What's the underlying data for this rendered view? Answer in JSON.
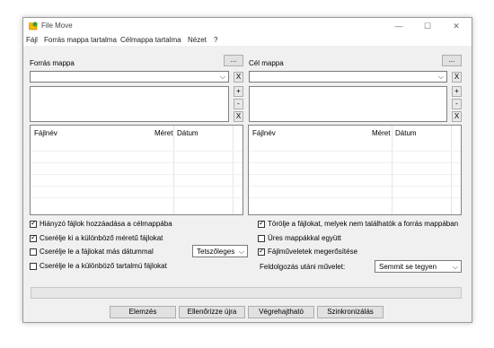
{
  "window": {
    "title": "File Move",
    "minimize": "—",
    "maximize": "☐",
    "close": "✕"
  },
  "menu": [
    "Fájl",
    "Forrás mappa tartalma",
    "Célmappa tartalma",
    "Nézet",
    "?"
  ],
  "source": {
    "label": "Forrás mappa",
    "browse": "...",
    "path": "",
    "clear": "X",
    "add": "+",
    "remove": "-",
    "clear_list": "X"
  },
  "target": {
    "label": "Cél mappa",
    "browse": "...",
    "path": "",
    "clear": "X",
    "add": "+",
    "remove": "-",
    "clear_list": "X"
  },
  "columns": {
    "name": "Fájlnév",
    "size": "Méret",
    "date": "Dátum"
  },
  "options_left": [
    {
      "label": "Hiányzó fájlok hozzáadása a célmappába",
      "checked": true
    },
    {
      "label": "Cserélje ki a különböző méretű fájlokat",
      "checked": true
    },
    {
      "label": "Cserélje le a fájlokat más dátummal",
      "checked": false
    },
    {
      "label": "Cserélje le a különböző tartalmú fájlokat",
      "checked": false
    }
  ],
  "date_mode": {
    "value": "Tetszőleges"
  },
  "options_right": [
    {
      "label": "Törölje a fájlokat, melyek nem találhatók a forrás mappában",
      "checked": true
    },
    {
      "label": "Üres mappákkal együtt",
      "checked": false
    },
    {
      "label": "Fájlműveletek megerősítése",
      "checked": true
    }
  ],
  "post_action": {
    "label": "Feldolgozás utáni művelet:",
    "value": "Semmit se tegyen"
  },
  "buttons": {
    "analyze": "Elemzés",
    "recheck": "Ellenőrizze újra",
    "execute": "Végrehajtható",
    "sync": "Szinkronizálás"
  },
  "icons": {
    "app": "folder-move-icon",
    "dropdown": "chevron-down-icon"
  },
  "colors": {
    "app_icon": "#f5b800",
    "app_icon_accent": "#3aa038"
  }
}
